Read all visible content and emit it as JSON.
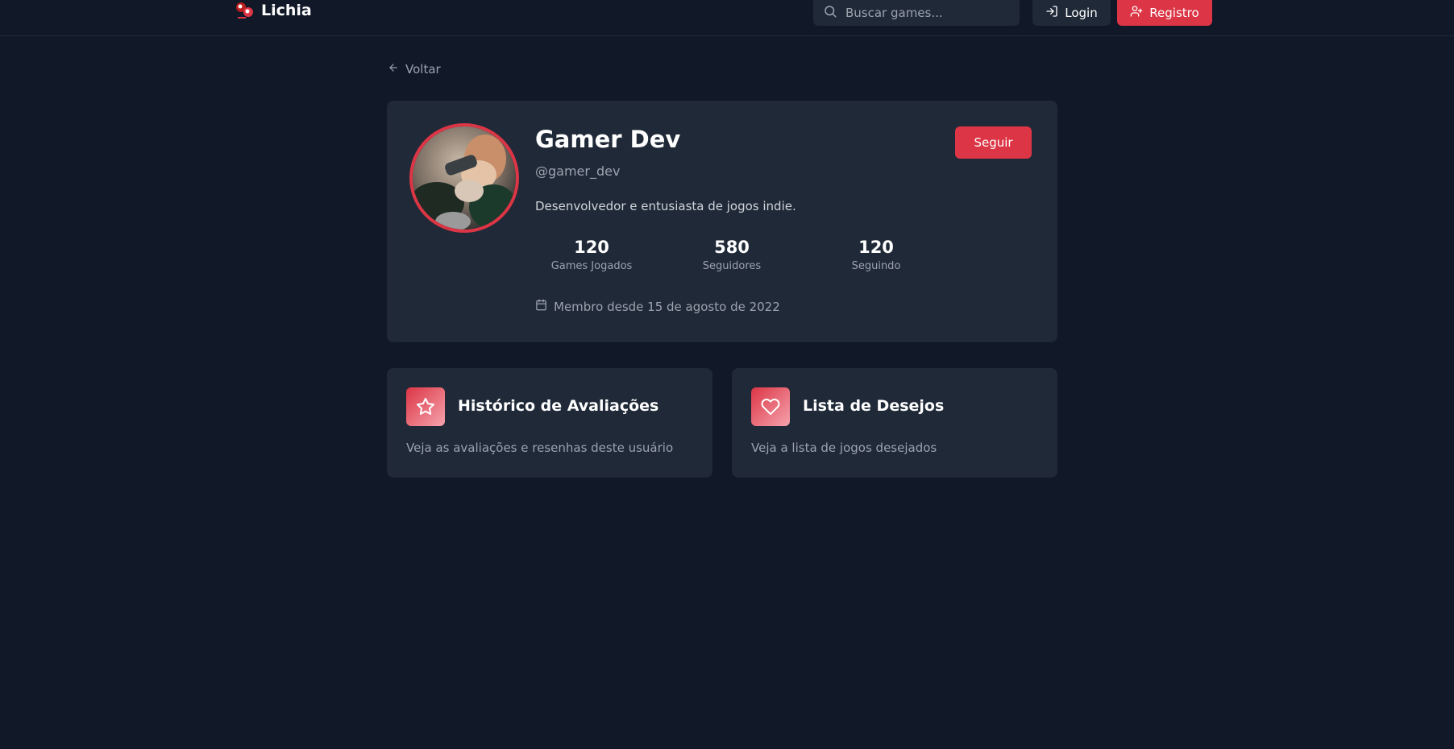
{
  "header": {
    "logo_text": "Lichia",
    "search_placeholder": "Buscar games...",
    "login_label": "Login",
    "register_label": "Registro"
  },
  "back_label": "Voltar",
  "profile": {
    "name": "Gamer Dev",
    "handle": "@gamer_dev",
    "bio": "Desenvolvedor e entusiasta de jogos indie.",
    "follow_label": "Seguir",
    "stats": [
      {
        "value": "120",
        "label": "Games Jogados"
      },
      {
        "value": "580",
        "label": "Seguidores"
      },
      {
        "value": "120",
        "label": "Seguindo"
      }
    ],
    "member_since": "Membro desde 15 de agosto de 2022"
  },
  "cards": [
    {
      "icon": "star-icon",
      "title": "Histórico de Avaliações",
      "description": "Veja as avaliações e resenhas deste usuário"
    },
    {
      "icon": "heart-icon",
      "title": "Lista de Desejos",
      "description": "Veja a lista de jogos desejados"
    }
  ],
  "colors": {
    "background": "#111827",
    "surface": "#1f2937",
    "accent": "#dc3545",
    "muted_text": "#9ca3af"
  }
}
